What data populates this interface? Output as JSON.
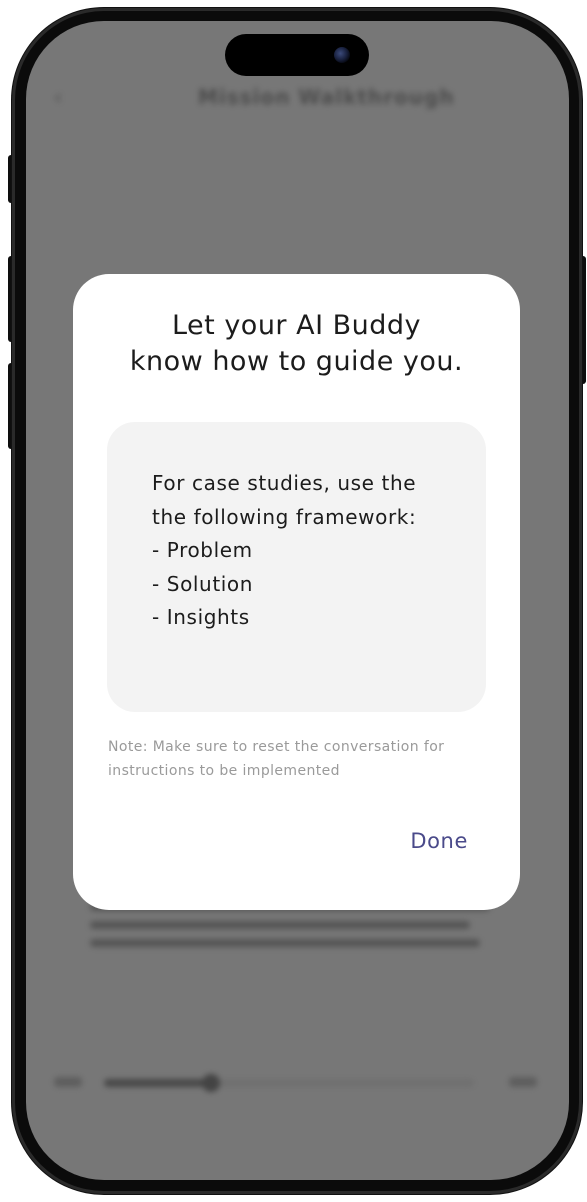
{
  "background_app": {
    "title": "Mission Walkthrough",
    "back_icon": "chevron-left-icon",
    "player_progress": 0.29
  },
  "dialog": {
    "title": "Let your AI Buddy\nknow how to guide you.",
    "instructions": "For case studies, use the\nthe following framework:\n- Problem\n- Solution\n- Insights",
    "note": "Note: Make sure to reset the conversation for instructions to be implemented",
    "done_label": "Done"
  },
  "colors": {
    "overlay": "#777777",
    "dialog_bg": "#ffffff",
    "input_bg": "#f3f3f3",
    "accent": "#4a4a8a",
    "note_text": "#9a9a9a"
  }
}
